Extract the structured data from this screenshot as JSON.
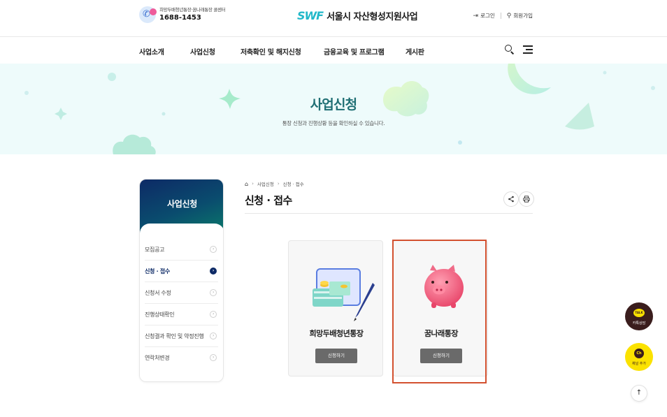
{
  "header": {
    "callcenter_label": "희망두배청년통장·꿈나래통장 콜센터",
    "callcenter_number": "1688-1453",
    "logo_mark": "SWF",
    "logo_text": "서울시 자산형성지원사업",
    "login": "로그인",
    "signup": "회원가입"
  },
  "nav": {
    "items": [
      "사업소개",
      "사업신청",
      "저축확인 및 해지신청",
      "금융교육 및 프로그램",
      "게시판"
    ]
  },
  "hero": {
    "title": "사업신청",
    "subtitle": "통장 신청과 진행상황 등을 확인하실 수 있습니다."
  },
  "sidebar": {
    "title": "사업신청",
    "items": [
      {
        "label": "모집공고",
        "active": false
      },
      {
        "label": "신청 · 접수",
        "active": true
      },
      {
        "label": "신청서 수정",
        "active": false
      },
      {
        "label": "진행상태확인",
        "active": false
      },
      {
        "label": "신청결과 확인 및 약정진행",
        "active": false
      },
      {
        "label": "연락처변경",
        "active": false
      }
    ]
  },
  "breadcrumb": {
    "items": [
      "사업신청",
      "신청 · 접수"
    ]
  },
  "content": {
    "title": "신청 · 접수",
    "cards": [
      {
        "name": "희망두배청년통장",
        "button": "신청하기"
      },
      {
        "name": "꿈나래통장",
        "button": "신청하기"
      }
    ]
  },
  "floating": {
    "kakao_talk_icon_text": "TALK",
    "kakao_talk_label": "카톡상담",
    "channel_icon_text": "Ch",
    "channel_label": "채널 추가",
    "top": "↑"
  },
  "colors": {
    "brand": "#22b8c9",
    "sidebar_head": "#0d2a66",
    "hero_bg": "#eefbfb",
    "hero_title": "#1f6f74",
    "highlight": "#d35130",
    "button": "#6a6a6a"
  }
}
